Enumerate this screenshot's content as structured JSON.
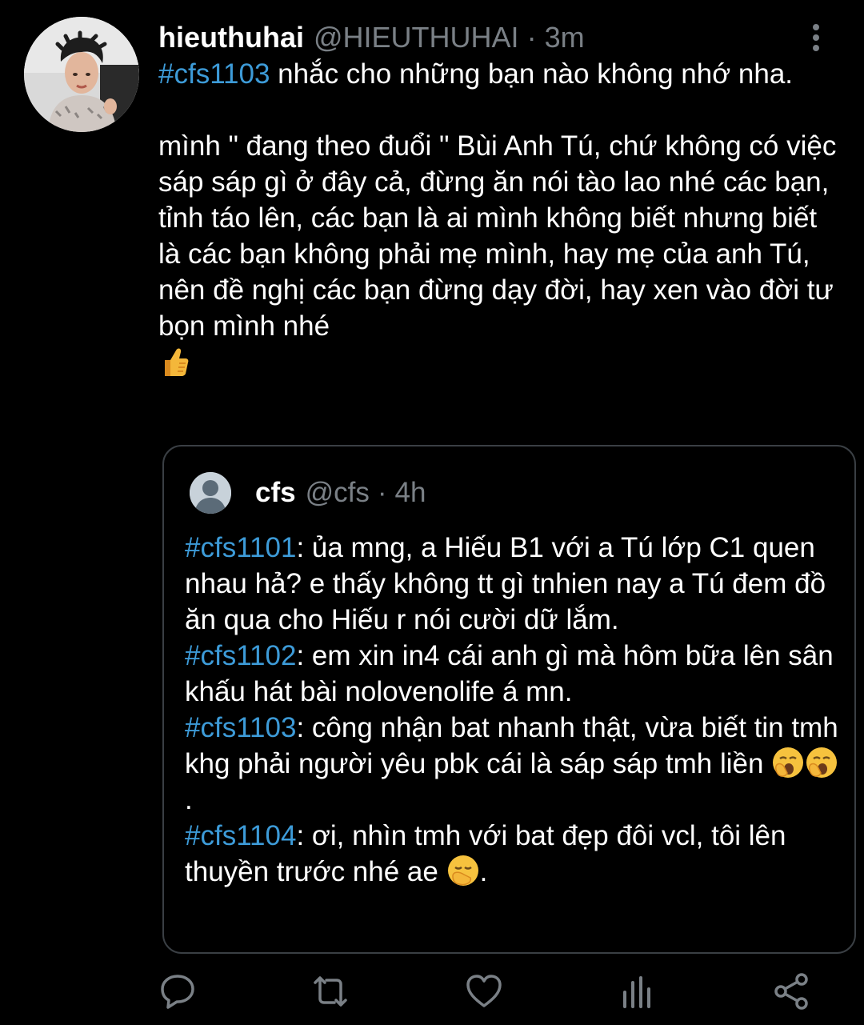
{
  "tweet": {
    "display_name": "hieuthuhai",
    "handle": "@HIEUTHUHAI",
    "separator": "·",
    "time": "3m",
    "line1_hashtag": "#cfs1103",
    "line1_rest": " nhắc cho những bạn nào không nhớ nha.",
    "paragraph2": "mình \" đang theo đuổi \" Bùi Anh Tú, chứ không có việc sáp sáp gì ở đây cả, đừng ăn nói tào lao nhé các bạn, tỉnh táo lên, các bạn là ai mình không biết nhưng biết là các bạn không phải mẹ mình, hay mẹ của anh Tú, nên đề nghị các bạn đừng dạy đời, hay xen vào đời tư bọn mình nhé",
    "end_emoji": "thumbs-up-icon"
  },
  "quote": {
    "display_name": "cfs",
    "handle": "@cfs",
    "separator": "·",
    "time": "4h",
    "entries": [
      {
        "hashtag": "#cfs1101",
        "text": ": ủa mng, a Hiếu B1 với a Tú lớp C1 quen nhau hả? e thấy không tt gì tnhien nay a Tú đem đồ ăn qua cho Hiếu r nói cười dữ lắm."
      },
      {
        "hashtag": "#cfs1102",
        "text": ": em xin in4 cái anh gì mà hôm bữa lên sân khấu hát bài nolovenolife á mn."
      },
      {
        "hashtag": "#cfs1103",
        "text": ": công nhận bat nhanh thật, vừa biết tin tmh khg phải người yêu pbk cái là sáp sáp tmh liền ",
        "tail": "."
      },
      {
        "hashtag": "#cfs1104",
        "text": ": ơi, nhìn tmh với bat đẹp đôi vcl, tôi lên thuyền trước nhé ae ",
        "tail": "."
      }
    ]
  },
  "actions": [
    "reply-icon",
    "retweet-icon",
    "like-icon",
    "analytics-icon",
    "share-icon"
  ],
  "colors": {
    "background": "#000000",
    "text": "#ffffff",
    "muted": "#7a8086",
    "hashtag": "#3d9bd8",
    "border": "#3a3f44",
    "icon": "#7a8086"
  }
}
